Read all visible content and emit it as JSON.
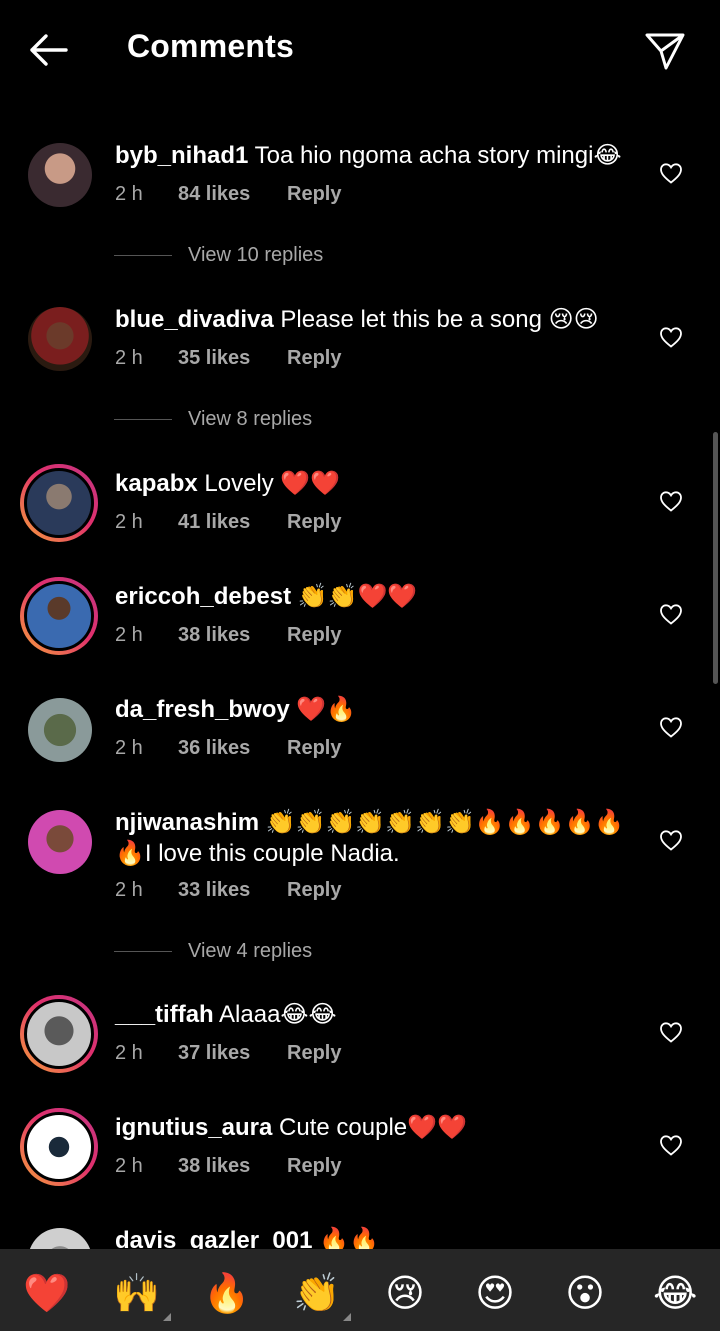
{
  "header": {
    "title": "Comments"
  },
  "comments": [
    {
      "username": "byb_nihad1",
      "text": "Toa hio ngoma acha story mingi😂",
      "time": "2 h",
      "likes": "84 likes",
      "reply": "Reply",
      "view_replies": "View 10 replies",
      "story_ring": false
    },
    {
      "username": "blue_divadiva",
      "text": "Please let this be a song 😢😢",
      "time": "2 h",
      "likes": "35 likes",
      "reply": "Reply",
      "view_replies": "View 8 replies",
      "story_ring": false
    },
    {
      "username": "kapabx",
      "text": "Lovely ❤️❤️",
      "time": "2 h",
      "likes": "41 likes",
      "reply": "Reply",
      "story_ring": true
    },
    {
      "username": "ericcoh_debest",
      "text": "👏👏❤️❤️",
      "time": "2 h",
      "likes": "38 likes",
      "reply": "Reply",
      "story_ring": true
    },
    {
      "username": "da_fresh_bwoy",
      "text": "❤️🔥",
      "time": "2 h",
      "likes": "36 likes",
      "reply": "Reply",
      "story_ring": false
    },
    {
      "username": "njiwanashim",
      "text": "👏👏👏👏👏👏👏🔥🔥🔥🔥🔥",
      "text_line2": "🔥I love this couple Nadia.",
      "time": "2 h",
      "likes": "33 likes",
      "reply": "Reply",
      "view_replies": "View 4 replies",
      "story_ring": false
    },
    {
      "username": "___tiffah",
      "text": "Alaaa😂😂",
      "time": "2 h",
      "likes": "37 likes",
      "reply": "Reply",
      "story_ring": true
    },
    {
      "username": "ignutius_aura",
      "text": "Cute couple❤️❤️",
      "time": "2 h",
      "likes": "38 likes",
      "reply": "Reply",
      "story_ring": true
    },
    {
      "username": "davis_gazler_001",
      "text": "🔥🔥",
      "story_ring": false
    }
  ],
  "emoji_bar": [
    "❤️",
    "🙌",
    "🔥",
    "👏",
    "😢",
    "😍",
    "😮",
    "😂"
  ],
  "icons": {
    "back": "arrow-left-icon",
    "send": "paper-plane-icon",
    "like": "heart-outline-icon"
  },
  "colors": {
    "background": "#000000",
    "secondary_text": "#a8a8a8",
    "emoji_bar": "#262626",
    "ring_start": "#f7a23b",
    "ring_end": "#c13584"
  }
}
